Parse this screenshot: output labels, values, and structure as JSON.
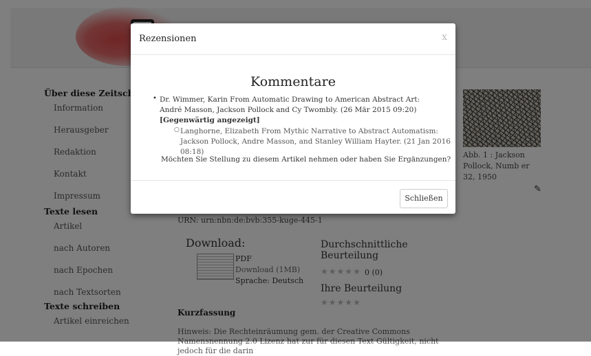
{
  "sidebar": {
    "section1": "Über diese Zeitschrift",
    "section1_items": [
      "Information",
      "Herausgeber",
      "Redaktion",
      "Kontakt",
      "Impressum"
    ],
    "section2": "Texte lesen",
    "section2_items": [
      "Artikel",
      "nach Autoren",
      "nach Epochen",
      "nach Textsorten"
    ],
    "section3": "Texte schreiben",
    "section3_items": [
      "Artikel einreichen"
    ]
  },
  "main": {
    "urn": "URN: urn:nbn:de:bvb:355-kuge-445-1",
    "download_title": "Download:",
    "pdf_label": "PDF",
    "pdf_size": "Download (1MB)",
    "pdf_language": "Sprache: Deutsch",
    "avg_rating_title": "Durchschnittliche Beurteilung",
    "avg_rating_count": "0 (0)",
    "own_rating_title": "Ihre Beurteilung",
    "summary_heading": "Kurzfassung",
    "notice": "Hinweis: Die Rechteinräumung gem. der Creative Commons Namensnennung 2.0 Lizenz hat zur für diesen Text Gültigkeit, nicht jedoch für die darin"
  },
  "side": {
    "caption": "Abb. 1 : Jackson Pollock, Numb er 32, 1950"
  },
  "modal": {
    "title": "Rezensionen",
    "close_x": "x",
    "heading": "Kommentare",
    "comment1_text": "Dr. Wimmer, Karin From Automatic Drawing to American Abstract Art: André Masson, Jackson Pollock and Cy Twombly. (26 Mär 2015 09:20) ",
    "comment1_current": "[Gegenwärtig angezeigt]",
    "comment2_text": "Langhorne, Elizabeth From Mythic Narrative to Abstract Automatism: Jackson Pollock, Andre Masson, and Stanley William Hayter. (21 Jan 2016 08:18)",
    "question": "Möchten Sie Stellung zu diesem Artikel nehmen oder haben Sie Ergänzungen?",
    "close_button": "Schließen"
  },
  "icons": {
    "star": "★",
    "pencil": "✎",
    "bullet": "•",
    "sub_bullet": "○"
  }
}
